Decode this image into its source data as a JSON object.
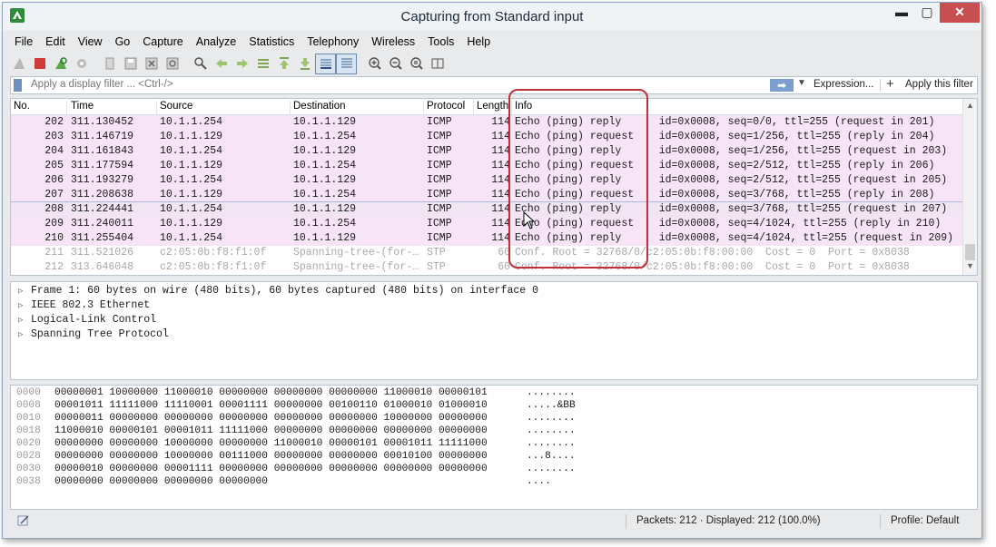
{
  "window": {
    "title": "Capturing from Standard input"
  },
  "menu": [
    "File",
    "Edit",
    "View",
    "Go",
    "Capture",
    "Analyze",
    "Statistics",
    "Telephony",
    "Wireless",
    "Tools",
    "Help"
  ],
  "toolbar": {
    "icons": [
      "shark-fin-start-icon",
      "stop-capture-icon",
      "restart-capture-icon",
      "capture-options-icon",
      "open-file-icon",
      "save-file-icon",
      "close-file-icon",
      "reload-file-icon",
      "find-packet-icon",
      "go-back-icon",
      "go-forward-icon",
      "go-to-packet-icon",
      "first-packet-icon",
      "last-packet-icon",
      "autoscroll-icon",
      "colorize-icon",
      "zoom-in-icon",
      "zoom-out-icon",
      "normal-size-icon",
      "resize-columns-icon"
    ]
  },
  "filter": {
    "placeholder": "Apply a display filter ... <Ctrl-/>",
    "expression_label": "Expression...",
    "apply_label": "Apply this filter"
  },
  "packet_list": {
    "columns": [
      "No.",
      "Time",
      "Source",
      "Destination",
      "Protocol",
      "Length",
      "Info"
    ],
    "rows": [
      {
        "no": "202",
        "time": "311.130452",
        "src": "10.1.1.254",
        "dst": "10.1.1.129",
        "proto": "ICMP",
        "len": "114",
        "info": "Echo (ping) reply      id=0x0008, seq=0/0, ttl=255 (request in 201)",
        "kind": "icmp"
      },
      {
        "no": "203",
        "time": "311.146719",
        "src": "10.1.1.129",
        "dst": "10.1.1.254",
        "proto": "ICMP",
        "len": "114",
        "info": "Echo (ping) request    id=0x0008, seq=1/256, ttl=255 (reply in 204)",
        "kind": "icmp"
      },
      {
        "no": "204",
        "time": "311.161843",
        "src": "10.1.1.254",
        "dst": "10.1.1.129",
        "proto": "ICMP",
        "len": "114",
        "info": "Echo (ping) reply      id=0x0008, seq=1/256, ttl=255 (request in 203)",
        "kind": "icmp"
      },
      {
        "no": "205",
        "time": "311.177594",
        "src": "10.1.1.129",
        "dst": "10.1.1.254",
        "proto": "ICMP",
        "len": "114",
        "info": "Echo (ping) request    id=0x0008, seq=2/512, ttl=255 (reply in 206)",
        "kind": "icmp"
      },
      {
        "no": "206",
        "time": "311.193279",
        "src": "10.1.1.254",
        "dst": "10.1.1.129",
        "proto": "ICMP",
        "len": "114",
        "info": "Echo (ping) reply      id=0x0008, seq=2/512, ttl=255 (request in 205)",
        "kind": "icmp"
      },
      {
        "no": "207",
        "time": "311.208638",
        "src": "10.1.1.129",
        "dst": "10.1.1.254",
        "proto": "ICMP",
        "len": "114",
        "info": "Echo (ping) request    id=0x0008, seq=3/768, ttl=255 (reply in 208)",
        "kind": "icmp"
      },
      {
        "no": "208",
        "time": "311.224441",
        "src": "10.1.1.254",
        "dst": "10.1.1.129",
        "proto": "ICMP",
        "len": "114",
        "info": "Echo (ping) reply      id=0x0008, seq=3/768, ttl=255 (request in 207)",
        "kind": "selected"
      },
      {
        "no": "209",
        "time": "311.240011",
        "src": "10.1.1.129",
        "dst": "10.1.1.254",
        "proto": "ICMP",
        "len": "114",
        "info": "Echo (ping) request    id=0x0008, seq=4/1024, ttl=255 (reply in 210)",
        "kind": "icmp"
      },
      {
        "no": "210",
        "time": "311.255404",
        "src": "10.1.1.254",
        "dst": "10.1.1.129",
        "proto": "ICMP",
        "len": "114",
        "info": "Echo (ping) reply      id=0x0008, seq=4/1024, ttl=255 (request in 209)",
        "kind": "icmp"
      },
      {
        "no": "211",
        "time": "311.521026",
        "src": "c2:05:0b:f8:f1:0f",
        "dst": "Spanning-tree-(for-…",
        "proto": "STP",
        "len": "60",
        "info": "Conf. Root = 32768/0/c2:05:0b:f8:00:00  Cost = 0  Port = 0x8038",
        "kind": "stp"
      },
      {
        "no": "212",
        "time": "313.646048",
        "src": "c2:05:0b:f8:f1:0f",
        "dst": "Spanning-tree-(for-…",
        "proto": "STP",
        "len": "60",
        "info": "Conf. Root = 32768/0/c2:05:0b:f8:00:00  Cost = 0  Port = 0x8038",
        "kind": "stp"
      }
    ]
  },
  "details": [
    "Frame 1: 60 bytes on wire (480 bits), 60 bytes captured (480 bits) on interface 0",
    "IEEE 802.3 Ethernet",
    "Logical-Link Control",
    "Spanning Tree Protocol"
  ],
  "bytes": [
    {
      "off": "0000",
      "bits": "00000001 10000000 11000010 00000000 00000000 00000000 11000010 00000101",
      "ascii": "........"
    },
    {
      "off": "0008",
      "bits": "00001011 11111000 11110001 00001111 00000000 00100110 01000010 01000010",
      "ascii": ".....&BB"
    },
    {
      "off": "0010",
      "bits": "00000011 00000000 00000000 00000000 00000000 00000000 10000000 00000000",
      "ascii": "........"
    },
    {
      "off": "0018",
      "bits": "11000010 00000101 00001011 11111000 00000000 00000000 00000000 00000000",
      "ascii": "........"
    },
    {
      "off": "0020",
      "bits": "00000000 00000000 10000000 00000000 11000010 00000101 00001011 11111000",
      "ascii": "........"
    },
    {
      "off": "0028",
      "bits": "00000000 00000000 10000000 00111000 00000000 00000000 00010100 00000000",
      "ascii": "...8...."
    },
    {
      "off": "0030",
      "bits": "00000010 00000000 00001111 00000000 00000000 00000000 00000000 00000000",
      "ascii": "........"
    },
    {
      "off": "0038",
      "bits": "00000000 00000000 00000000 00000000",
      "ascii": "...."
    }
  ],
  "status": {
    "packets": "Packets: 212 · Displayed: 212 (100.0%)",
    "profile": "Profile: Default"
  },
  "colors": {
    "icmp_row": "#f7e4f7",
    "highlight": "#c0303a",
    "accent": "#6f8fbf"
  }
}
